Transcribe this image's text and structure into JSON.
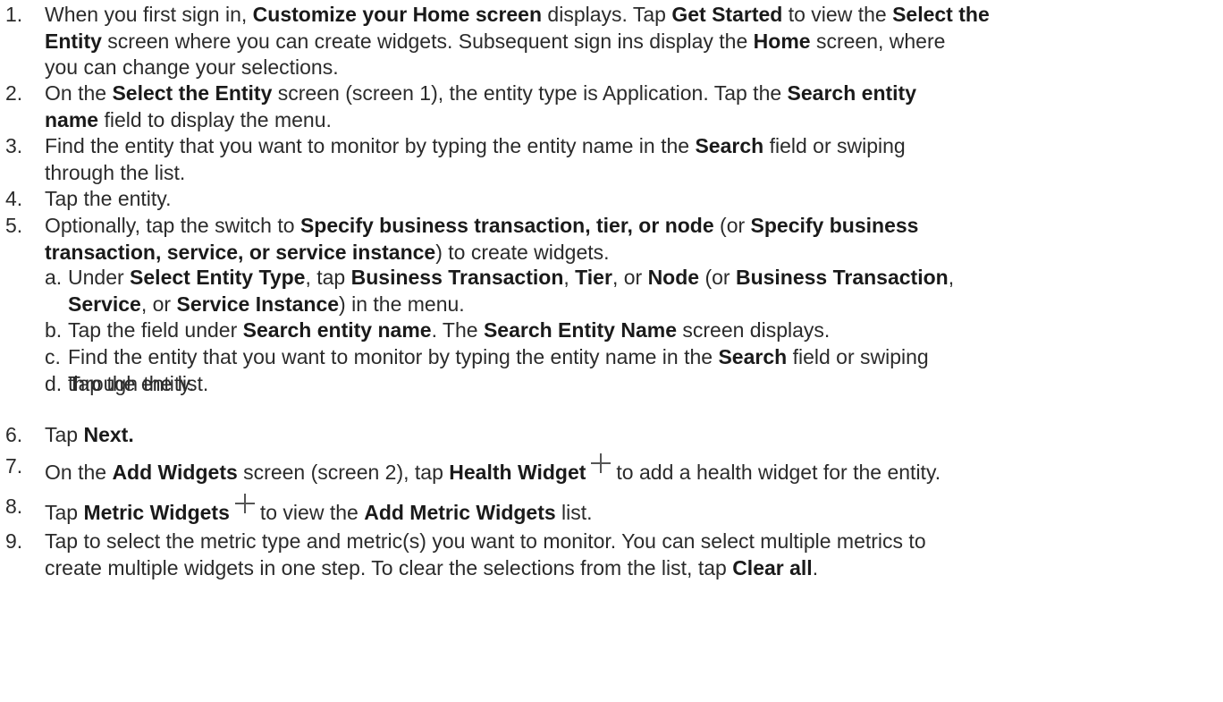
{
  "steps": [
    {
      "num": "1.",
      "lines": [
        [
          [
            "When you first sign in, ",
            false
          ],
          [
            "Customize your Home screen",
            true
          ],
          [
            " displays. Tap ",
            false
          ],
          [
            "Get Started",
            true
          ],
          [
            " to view the ",
            false
          ],
          [
            "Select the",
            true
          ]
        ],
        [
          [
            "Entity",
            true
          ],
          [
            " screen where you can create widgets. Subsequent sign ins display the ",
            false
          ],
          [
            "Home",
            true
          ],
          [
            " screen, where",
            false
          ]
        ],
        [
          [
            "you can change your selections.",
            false
          ]
        ]
      ]
    },
    {
      "num": "2.",
      "lines": [
        [
          [
            "On the ",
            false
          ],
          [
            "Select the Entity",
            true
          ],
          [
            " screen (screen 1), the entity type is Application. Tap the ",
            false
          ],
          [
            "Search entity",
            true
          ]
        ],
        [
          [
            "name",
            true
          ],
          [
            " field to display the menu.",
            false
          ]
        ]
      ]
    },
    {
      "num": "3.",
      "lines": [
        [
          [
            "Find the entity that you want to monitor by typing the entity name in the ",
            false
          ],
          [
            "Search",
            true
          ],
          [
            " field or swiping",
            false
          ]
        ],
        [
          [
            "through the list.",
            false
          ]
        ]
      ]
    },
    {
      "num": "4.",
      "lines": [
        [
          [
            "Tap the entity.",
            false
          ]
        ]
      ]
    },
    {
      "num": "5.",
      "lines": [
        [
          [
            "Optionally, tap the switch to ",
            false
          ],
          [
            "Specify business transaction, tier, or node",
            true
          ],
          [
            " (or ",
            false
          ],
          [
            "Specify business",
            true
          ]
        ],
        [
          [
            "transaction, service, or service instance",
            true
          ],
          [
            ") to create widgets.",
            false
          ]
        ]
      ]
    },
    {
      "num": "a.",
      "sub": true,
      "lines": [
        [
          [
            "Under ",
            false
          ],
          [
            "Select Entity Type",
            true
          ],
          [
            ", tap ",
            false
          ],
          [
            "Business Transaction",
            true
          ],
          [
            ", ",
            false
          ],
          [
            "Tier",
            true
          ],
          [
            ", or ",
            false
          ],
          [
            "Node",
            true
          ],
          [
            " (or ",
            false
          ],
          [
            "Business Transaction",
            true
          ],
          [
            ",",
            false
          ]
        ],
        [
          [
            "Service",
            true
          ],
          [
            ", or ",
            false
          ],
          [
            "Service Instance",
            true
          ],
          [
            ") in the menu.",
            false
          ]
        ]
      ]
    },
    {
      "num": "b.",
      "sub": true,
      "lines": [
        [
          [
            "Tap the field under ",
            false
          ],
          [
            "Search entity name",
            true
          ],
          [
            ". The ",
            false
          ],
          [
            "Search Entity Name",
            true
          ],
          [
            " screen displays.",
            false
          ]
        ]
      ]
    },
    {
      "num": "c.",
      "sub": true,
      "lines": [
        [
          [
            "Find the entity that you want to monitor by typing the entity name in the ",
            false
          ],
          [
            "Search",
            true
          ],
          [
            " field or swiping",
            false
          ]
        ],
        [
          [
            "through the list.",
            false
          ]
        ]
      ]
    },
    {
      "num": "d.",
      "sub": true,
      "lines": [
        [
          [
            "Tap the entity.",
            false
          ]
        ]
      ]
    },
    {
      "num": "6.",
      "lines": [
        [
          [
            "Tap ",
            false
          ],
          [
            "Next.",
            true
          ]
        ]
      ]
    },
    {
      "num": "7.",
      "lines": [
        [
          [
            "On the ",
            false
          ],
          [
            "Add Widgets",
            true
          ],
          [
            " screen (screen 2), tap ",
            false
          ],
          [
            "Health Widget",
            true
          ],
          [
            "+",
            "icon"
          ],
          [
            "to add a health widget for the entity.",
            false
          ]
        ]
      ]
    },
    {
      "num": "8.",
      "lines": [
        [
          [
            "Tap ",
            false
          ],
          [
            "Metric Widgets",
            true
          ],
          [
            "+",
            "icon"
          ],
          [
            "to view the ",
            false
          ],
          [
            "Add Metric Widgets",
            true
          ],
          [
            " list.",
            false
          ]
        ]
      ]
    },
    {
      "num": "9.",
      "lines": [
        [
          [
            "Tap to select the metric type and metric(s) you want to monitor. You can select multiple metrics to",
            false
          ]
        ],
        [
          [
            "create multiple widgets in one step. To clear the selections from the list, tap ",
            false
          ],
          [
            "Clear all",
            true
          ],
          [
            ".",
            false
          ]
        ]
      ]
    }
  ]
}
